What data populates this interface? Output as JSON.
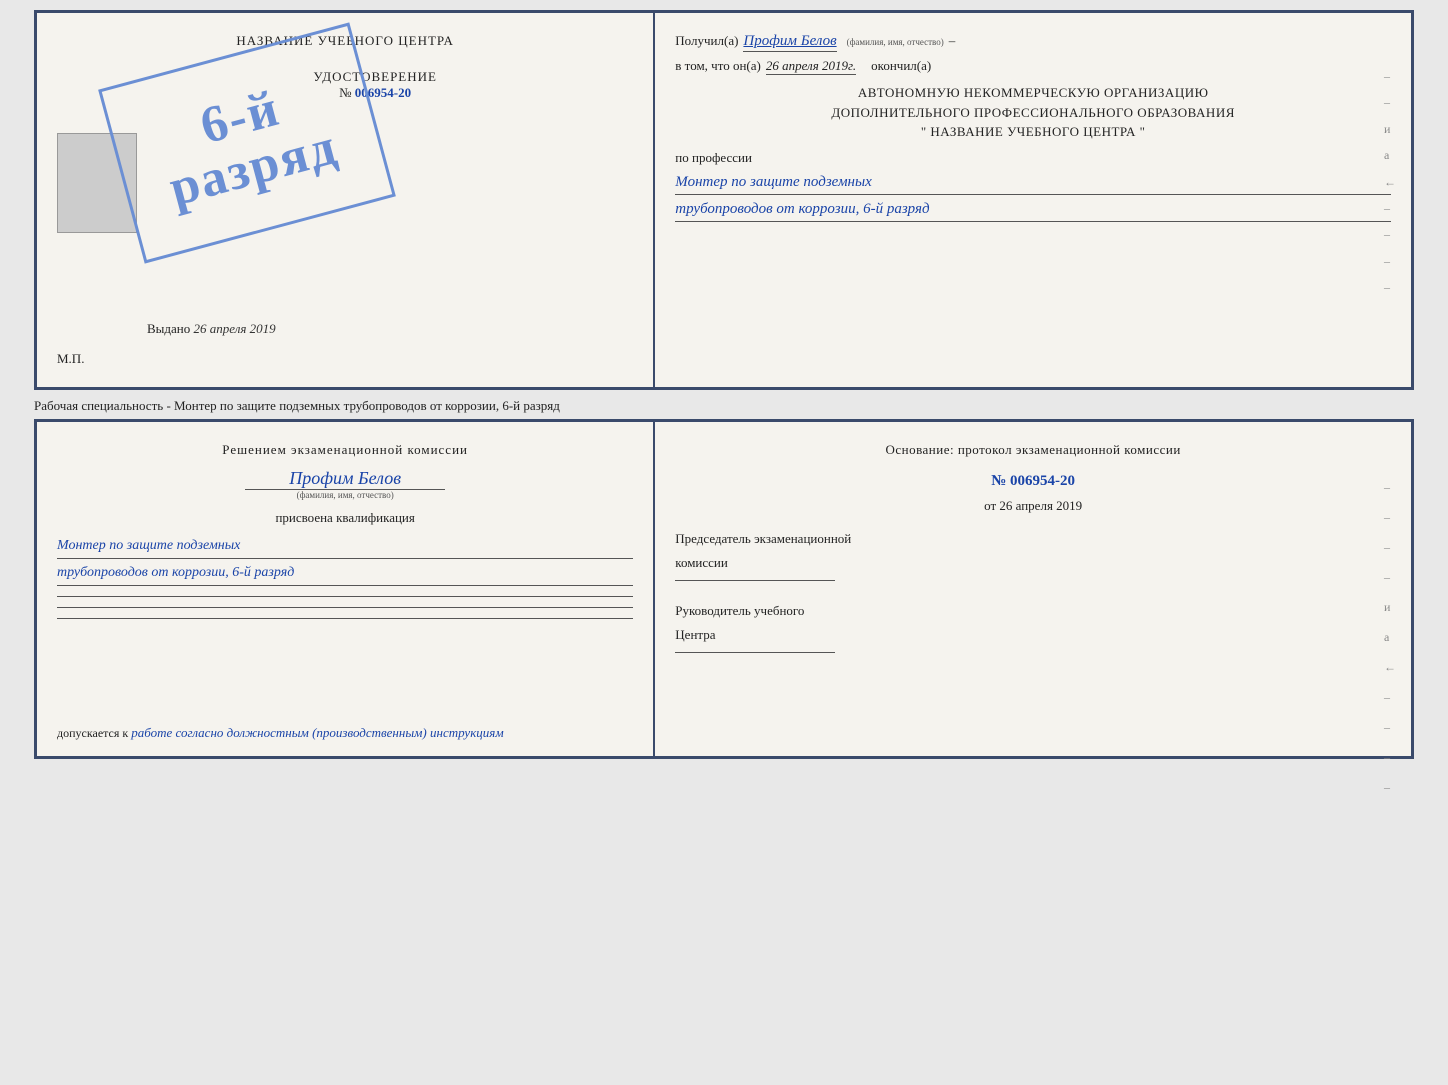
{
  "page": {
    "background_color": "#e8e8e8"
  },
  "top_cert": {
    "left": {
      "title_label": "НАЗВАНИЕ УЧЕБНОГО ЦЕНТРА",
      "photo_placeholder": "",
      "udostoverenie_title": "УДОСТОВЕРЕНИЕ",
      "udostoverenie_prefix": "№",
      "udostoverenie_number": "006954-20",
      "stamp_line1": "6-й",
      "stamp_line2": "разряд",
      "vydano_label": "Выдано",
      "vydano_date": "26 апреля 2019",
      "mp_label": "М.П."
    },
    "right": {
      "poluchil_label": "Получил(а)",
      "poluchil_name": "Профим Белов",
      "fio_sub": "(фамилия, имя, отчество)",
      "dash": "–",
      "vtom_label": "в том, что он(а)",
      "vtom_date": "26 апреля 2019г.",
      "okончil_label": "окончил(а)",
      "org_line1": "АВТОНОМНУЮ НЕКОММЕРЧЕСКУЮ ОРГАНИЗАЦИЮ",
      "org_line2": "ДОПОЛНИТЕЛЬНОГО ПРОФЕССИОНАЛЬНОГО ОБРАЗОВАНИЯ",
      "org_line3": "\"  НАЗВАНИЕ УЧЕБНОГО ЦЕНТРА  \"",
      "po_professii": "по профессии",
      "professiya_line1": "Монтер по защите подземных",
      "professiya_line2": "трубопроводов от коррозии, 6-й разряд",
      "side_chars": [
        "–",
        "–",
        "и",
        "а",
        "←",
        "–",
        "–",
        "–",
        "–"
      ]
    }
  },
  "separator": {
    "text": "Рабочая специальность - Монтер по защите подземных трубопроводов от коррозии, 6-й разряд"
  },
  "bottom_cert": {
    "left": {
      "resheniem_title": "Решением  экзаменационной  комиссии",
      "name_handwritten": "Профим Белов",
      "fio_sub": "(фамилия, имя, отчество)",
      "prisvoena_label": "присвоена квалификация",
      "kval_line1": "Монтер по защите подземных",
      "kval_line2": "трубопроводов от коррозии, 6-й разряд",
      "dopuskaetsya_label": "допускается к",
      "dopuskaetsya_text": "работе согласно должностным (производственным) инструкциям"
    },
    "right": {
      "osnovanie_title": "Основание: протокол  экзаменационной  комиссии",
      "protocol_prefix": "№",
      "protocol_number": "006954-20",
      "ot_prefix": "от",
      "ot_date": "26 апреля 2019",
      "predsedatel_label1": "Председатель экзаменационной",
      "predsedatel_label2": "комиссии",
      "rukovoditel_label1": "Руководитель учебного",
      "rukovoditel_label2": "Центра",
      "side_chars": [
        "–",
        "–",
        "–",
        "–",
        "и",
        "а",
        "←",
        "–",
        "–",
        "–",
        "–"
      ]
    }
  }
}
